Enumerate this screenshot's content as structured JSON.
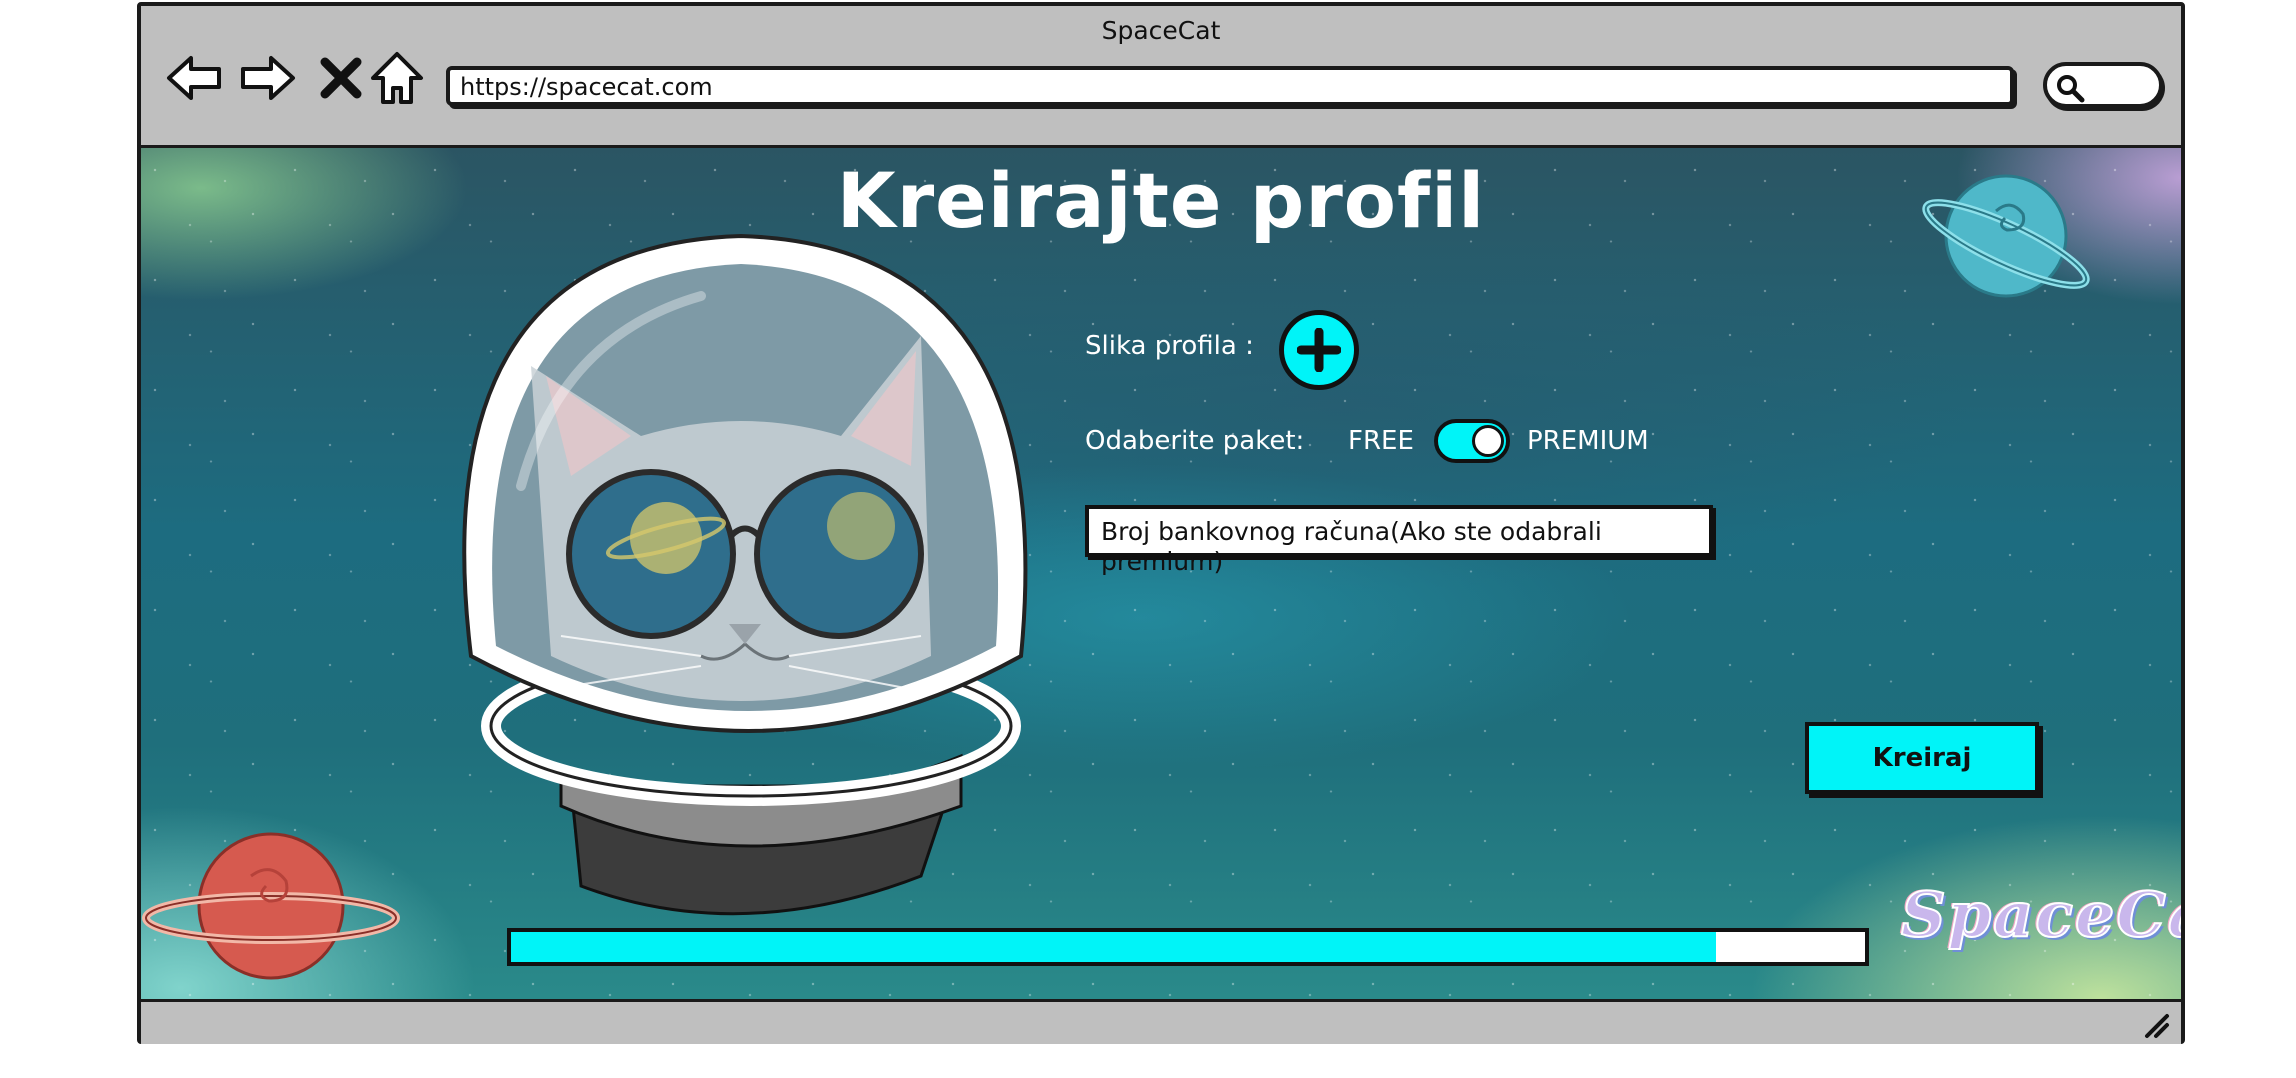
{
  "window": {
    "title": "SpaceCat",
    "url": "https://spacecat.com"
  },
  "nav": {
    "back_icon": "back-arrow-icon",
    "forward_icon": "forward-arrow-icon",
    "stop_icon": "close-icon",
    "home_icon": "home-icon",
    "search_icon": "search-icon"
  },
  "page": {
    "title": "Kreirajte profil",
    "profile_picture_label": "Slika profila :",
    "package_label": "Odaberite paket:",
    "package_free": "FREE",
    "package_premium": "PREMIUM",
    "package_selected": "PREMIUM",
    "bank_account_placeholder": "Broj bankovnog računa(Ako ste odabrali premium)",
    "submit_label": "Kreiraj",
    "progress_fraction": 0.89,
    "brand_logo": "SpaceCat"
  },
  "colors": {
    "accent": "#00f4f8",
    "frame": "#bfbfbf",
    "planet_red": "#d65a4f",
    "planet_blue": "#4fb8c9"
  }
}
